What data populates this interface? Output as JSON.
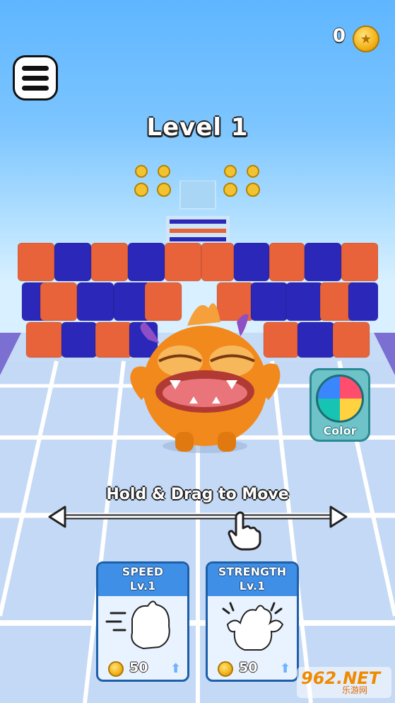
{
  "hud": {
    "coin_count": "0",
    "coin_icon": "star-coin-icon",
    "menu_icon": "hamburger-menu-icon",
    "level_title": "Level 1"
  },
  "game": {
    "color_button_label": "Color",
    "hint": "Hold & Drag to Move",
    "colors": {
      "orange_block": "#e8623a",
      "blue_block": "#2b27b8",
      "monster": "#f2891c",
      "track": "#c5dbf6",
      "sky": "#5fb6ff"
    }
  },
  "upgrades": [
    {
      "title": "SPEED",
      "level": "Lv.1",
      "price": "50"
    },
    {
      "title": "STRENGTH",
      "level": "Lv.1",
      "price": "50"
    }
  ],
  "watermark": {
    "brand": "962.NET",
    "sub": "乐游网"
  }
}
